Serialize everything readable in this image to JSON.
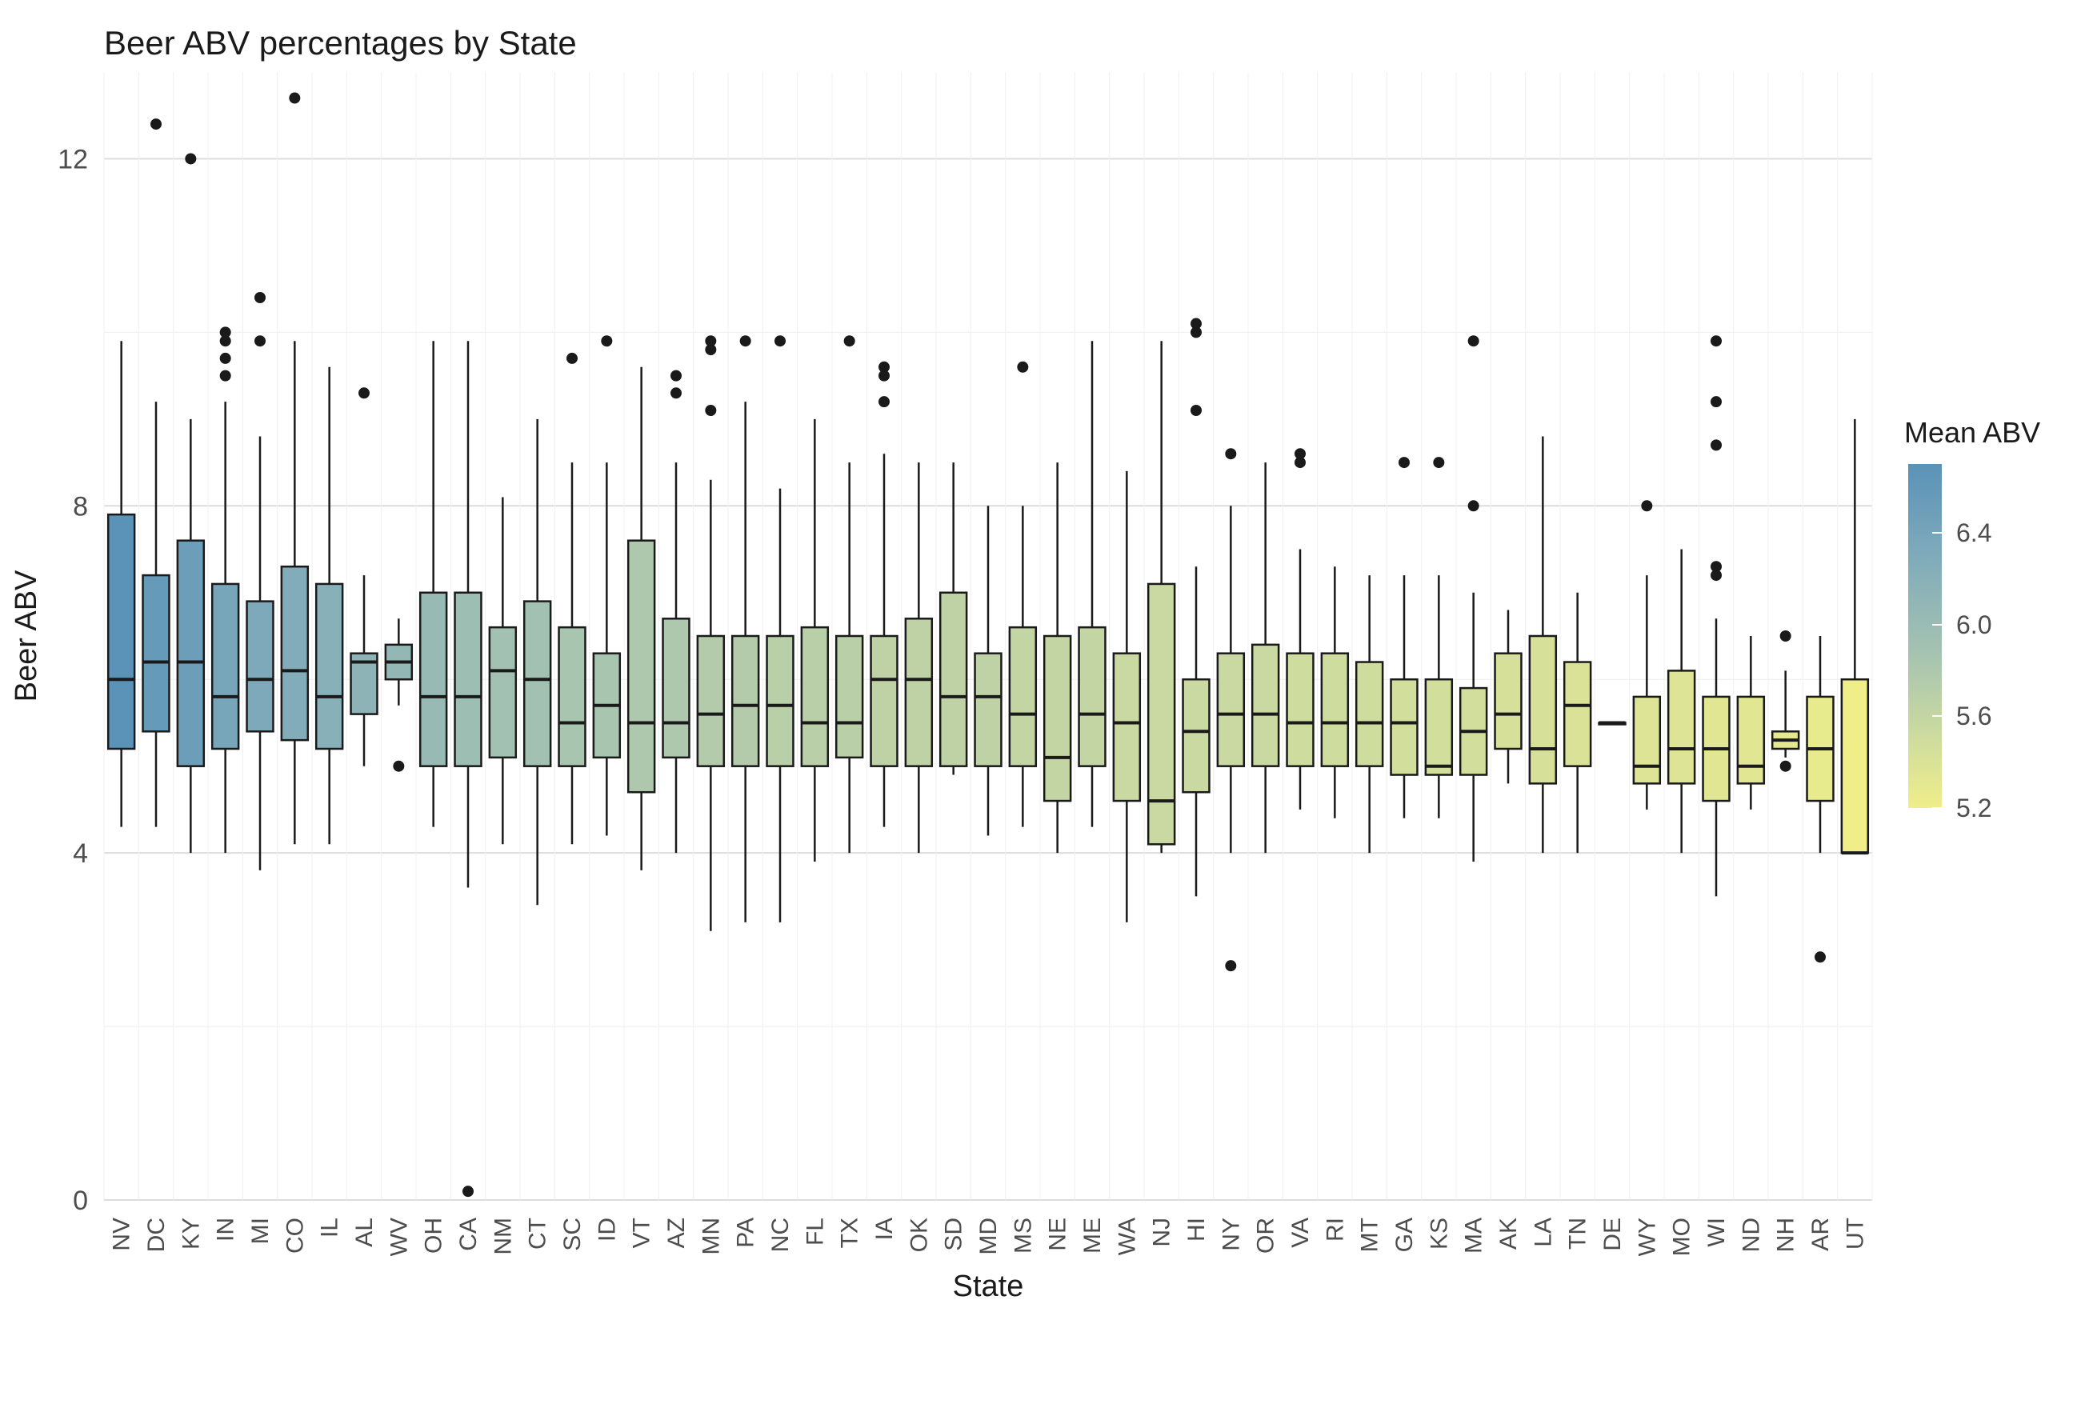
{
  "chart_data": {
    "type": "boxplot",
    "title": "Beer ABV percentages by State",
    "xlabel": "State",
    "ylabel": "Beer ABV",
    "ylim": [
      0,
      13
    ],
    "y_ticks": [
      0,
      4,
      8,
      12
    ],
    "legend": {
      "title": "Mean ABV",
      "min": 5.2,
      "max": 6.7,
      "ticks": [
        5.2,
        5.6,
        6.0,
        6.4
      ]
    },
    "categories": [
      "NV",
      "DC",
      "KY",
      "IN",
      "MI",
      "CO",
      "IL",
      "AL",
      "WV",
      "OH",
      "CA",
      "NM",
      "CT",
      "SC",
      "ID",
      "VT",
      "AZ",
      "MN",
      "PA",
      "NC",
      "FL",
      "TX",
      "IA",
      "OK",
      "SD",
      "MD",
      "MS",
      "NE",
      "ME",
      "WA",
      "NJ",
      "HI",
      "NY",
      "OR",
      "VA",
      "RI",
      "MT",
      "GA",
      "KS",
      "MA",
      "AK",
      "LA",
      "TN",
      "DE",
      "WY",
      "MO",
      "WI",
      "ND",
      "NH",
      "AR",
      "UT"
    ],
    "series": [
      {
        "name": "NV",
        "mean_abv": 6.7,
        "min": 4.3,
        "q1": 5.2,
        "median": 6.0,
        "q3": 7.9,
        "max": 9.9,
        "outliers": []
      },
      {
        "name": "DC",
        "mean_abv": 6.6,
        "min": 4.3,
        "q1": 5.4,
        "median": 6.2,
        "q3": 7.2,
        "max": 9.2,
        "outliers": [
          12.4
        ]
      },
      {
        "name": "KY",
        "mean_abv": 6.55,
        "min": 4.0,
        "q1": 5.0,
        "median": 6.2,
        "q3": 7.6,
        "max": 9.0,
        "outliers": [
          12.0
        ]
      },
      {
        "name": "IN",
        "mean_abv": 6.45,
        "min": 4.0,
        "q1": 5.2,
        "median": 5.8,
        "q3": 7.1,
        "max": 9.2,
        "outliers": [
          9.9,
          10.0,
          9.7,
          9.5
        ]
      },
      {
        "name": "MI",
        "mean_abv": 6.4,
        "min": 3.8,
        "q1": 5.4,
        "median": 6.0,
        "q3": 6.9,
        "max": 8.8,
        "outliers": [
          9.9,
          10.4
        ]
      },
      {
        "name": "CO",
        "mean_abv": 6.35,
        "min": 4.1,
        "q1": 5.3,
        "median": 6.1,
        "q3": 7.3,
        "max": 9.9,
        "outliers": [
          12.7
        ]
      },
      {
        "name": "IL",
        "mean_abv": 6.3,
        "min": 4.1,
        "q1": 5.2,
        "median": 5.8,
        "q3": 7.1,
        "max": 9.6,
        "outliers": []
      },
      {
        "name": "AL",
        "mean_abv": 6.25,
        "min": 5.0,
        "q1": 5.6,
        "median": 6.2,
        "q3": 6.3,
        "max": 7.2,
        "outliers": [
          9.3
        ]
      },
      {
        "name": "WV",
        "mean_abv": 6.2,
        "min": 5.7,
        "q1": 6.0,
        "median": 6.2,
        "q3": 6.4,
        "max": 6.7,
        "outliers": [
          5.0
        ]
      },
      {
        "name": "OH",
        "mean_abv": 6.15,
        "min": 4.3,
        "q1": 5.0,
        "median": 5.8,
        "q3": 7.0,
        "max": 9.9,
        "outliers": []
      },
      {
        "name": "CA",
        "mean_abv": 6.1,
        "min": 3.6,
        "q1": 5.0,
        "median": 5.8,
        "q3": 7.0,
        "max": 9.9,
        "outliers": [
          0.1
        ]
      },
      {
        "name": "NM",
        "mean_abv": 6.05,
        "min": 4.1,
        "q1": 5.1,
        "median": 6.1,
        "q3": 6.6,
        "max": 8.1,
        "outliers": []
      },
      {
        "name": "CT",
        "mean_abv": 6.05,
        "min": 3.4,
        "q1": 5.0,
        "median": 6.0,
        "q3": 6.9,
        "max": 9.0,
        "outliers": []
      },
      {
        "name": "SC",
        "mean_abv": 6.0,
        "min": 4.1,
        "q1": 5.0,
        "median": 5.5,
        "q3": 6.6,
        "max": 8.5,
        "outliers": [
          9.7
        ]
      },
      {
        "name": "ID",
        "mean_abv": 6.0,
        "min": 4.2,
        "q1": 5.1,
        "median": 5.7,
        "q3": 6.3,
        "max": 8.5,
        "outliers": [
          9.9
        ]
      },
      {
        "name": "VT",
        "mean_abv": 5.95,
        "min": 3.8,
        "q1": 4.7,
        "median": 5.5,
        "q3": 7.6,
        "max": 9.6,
        "outliers": []
      },
      {
        "name": "AZ",
        "mean_abv": 5.95,
        "min": 4.0,
        "q1": 5.1,
        "median": 5.5,
        "q3": 6.7,
        "max": 8.5,
        "outliers": [
          9.3,
          9.5
        ]
      },
      {
        "name": "MN",
        "mean_abv": 5.9,
        "min": 3.1,
        "q1": 5.0,
        "median": 5.6,
        "q3": 6.5,
        "max": 8.3,
        "outliers": [
          9.9,
          9.8,
          9.1
        ]
      },
      {
        "name": "PA",
        "mean_abv": 5.9,
        "min": 3.2,
        "q1": 5.0,
        "median": 5.7,
        "q3": 6.5,
        "max": 9.2,
        "outliers": [
          9.9
        ]
      },
      {
        "name": "NC",
        "mean_abv": 5.85,
        "min": 3.2,
        "q1": 5.0,
        "median": 5.7,
        "q3": 6.5,
        "max": 8.2,
        "outliers": [
          9.9
        ]
      },
      {
        "name": "FL",
        "mean_abv": 5.85,
        "min": 3.9,
        "q1": 5.0,
        "median": 5.5,
        "q3": 6.6,
        "max": 9.0,
        "outliers": []
      },
      {
        "name": "TX",
        "mean_abv": 5.85,
        "min": 4.0,
        "q1": 5.1,
        "median": 5.5,
        "q3": 6.5,
        "max": 8.5,
        "outliers": [
          9.9
        ]
      },
      {
        "name": "IA",
        "mean_abv": 5.8,
        "min": 4.3,
        "q1": 5.0,
        "median": 6.0,
        "q3": 6.5,
        "max": 8.6,
        "outliers": [
          9.5,
          9.6,
          9.2
        ]
      },
      {
        "name": "OK",
        "mean_abv": 5.8,
        "min": 4.0,
        "q1": 5.0,
        "median": 6.0,
        "q3": 6.7,
        "max": 8.5,
        "outliers": []
      },
      {
        "name": "SD",
        "mean_abv": 5.8,
        "min": 4.9,
        "q1": 5.0,
        "median": 5.8,
        "q3": 7.0,
        "max": 8.5,
        "outliers": []
      },
      {
        "name": "MD",
        "mean_abv": 5.8,
        "min": 4.2,
        "q1": 5.0,
        "median": 5.8,
        "q3": 6.3,
        "max": 8.0,
        "outliers": []
      },
      {
        "name": "MS",
        "mean_abv": 5.75,
        "min": 4.3,
        "q1": 5.0,
        "median": 5.6,
        "q3": 6.6,
        "max": 8.0,
        "outliers": [
          9.6
        ]
      },
      {
        "name": "NE",
        "mean_abv": 5.75,
        "min": 4.0,
        "q1": 4.6,
        "median": 5.1,
        "q3": 6.5,
        "max": 8.5,
        "outliers": []
      },
      {
        "name": "ME",
        "mean_abv": 5.75,
        "min": 4.3,
        "q1": 5.0,
        "median": 5.6,
        "q3": 6.6,
        "max": 9.9,
        "outliers": []
      },
      {
        "name": "WA",
        "mean_abv": 5.7,
        "min": 3.2,
        "q1": 4.6,
        "median": 5.5,
        "q3": 6.3,
        "max": 8.4,
        "outliers": []
      },
      {
        "name": "NJ",
        "mean_abv": 5.7,
        "min": 4.0,
        "q1": 4.1,
        "median": 4.6,
        "q3": 7.1,
        "max": 9.9,
        "outliers": []
      },
      {
        "name": "HI",
        "mean_abv": 5.7,
        "min": 3.5,
        "q1": 4.7,
        "median": 5.4,
        "q3": 6.0,
        "max": 7.3,
        "outliers": [
          9.1,
          10.0,
          10.1
        ]
      },
      {
        "name": "NY",
        "mean_abv": 5.7,
        "min": 4.0,
        "q1": 5.0,
        "median": 5.6,
        "q3": 6.3,
        "max": 8.0,
        "outliers": [
          8.6,
          2.7
        ]
      },
      {
        "name": "OR",
        "mean_abv": 5.7,
        "min": 4.0,
        "q1": 5.0,
        "median": 5.6,
        "q3": 6.4,
        "max": 8.5,
        "outliers": []
      },
      {
        "name": "VA",
        "mean_abv": 5.65,
        "min": 4.5,
        "q1": 5.0,
        "median": 5.5,
        "q3": 6.3,
        "max": 7.5,
        "outliers": [
          8.6,
          8.5
        ]
      },
      {
        "name": "RI",
        "mean_abv": 5.65,
        "min": 4.4,
        "q1": 5.0,
        "median": 5.5,
        "q3": 6.3,
        "max": 7.3,
        "outliers": []
      },
      {
        "name": "MT",
        "mean_abv": 5.65,
        "min": 4.0,
        "q1": 5.0,
        "median": 5.5,
        "q3": 6.2,
        "max": 7.2,
        "outliers": []
      },
      {
        "name": "GA",
        "mean_abv": 5.6,
        "min": 4.4,
        "q1": 4.9,
        "median": 5.5,
        "q3": 6.0,
        "max": 7.2,
        "outliers": [
          8.5
        ]
      },
      {
        "name": "KS",
        "mean_abv": 5.6,
        "min": 4.4,
        "q1": 4.9,
        "median": 5.0,
        "q3": 6.0,
        "max": 7.2,
        "outliers": [
          8.5
        ]
      },
      {
        "name": "MA",
        "mean_abv": 5.6,
        "min": 3.9,
        "q1": 4.9,
        "median": 5.4,
        "q3": 5.9,
        "max": 7.0,
        "outliers": [
          8.0,
          9.9
        ]
      },
      {
        "name": "AK",
        "mean_abv": 5.55,
        "min": 4.8,
        "q1": 5.2,
        "median": 5.6,
        "q3": 6.3,
        "max": 6.8,
        "outliers": []
      },
      {
        "name": "LA",
        "mean_abv": 5.55,
        "min": 4.0,
        "q1": 4.8,
        "median": 5.2,
        "q3": 6.5,
        "max": 8.8,
        "outliers": []
      },
      {
        "name": "TN",
        "mean_abv": 5.5,
        "min": 4.0,
        "q1": 5.0,
        "median": 5.7,
        "q3": 6.2,
        "max": 7.0,
        "outliers": []
      },
      {
        "name": "DE",
        "mean_abv": 5.5,
        "min": 5.5,
        "q1": 5.5,
        "median": 5.5,
        "q3": 5.5,
        "max": 5.5,
        "outliers": []
      },
      {
        "name": "WY",
        "mean_abv": 5.45,
        "min": 4.5,
        "q1": 4.8,
        "median": 5.0,
        "q3": 5.8,
        "max": 7.2,
        "outliers": [
          8.0
        ]
      },
      {
        "name": "MO",
        "mean_abv": 5.45,
        "min": 4.0,
        "q1": 4.8,
        "median": 5.2,
        "q3": 6.1,
        "max": 7.5,
        "outliers": []
      },
      {
        "name": "WI",
        "mean_abv": 5.4,
        "min": 3.5,
        "q1": 4.6,
        "median": 5.2,
        "q3": 5.8,
        "max": 6.7,
        "outliers": [
          7.2,
          7.3,
          8.7,
          9.2,
          9.9
        ]
      },
      {
        "name": "ND",
        "mean_abv": 5.4,
        "min": 4.5,
        "q1": 4.8,
        "median": 5.0,
        "q3": 5.8,
        "max": 6.5,
        "outliers": []
      },
      {
        "name": "NH",
        "mean_abv": 5.35,
        "min": 5.1,
        "q1": 5.2,
        "median": 5.3,
        "q3": 5.4,
        "max": 6.1,
        "outliers": [
          5.0,
          6.5
        ]
      },
      {
        "name": "AR",
        "mean_abv": 5.3,
        "min": 4.0,
        "q1": 4.6,
        "median": 5.2,
        "q3": 5.8,
        "max": 6.5,
        "outliers": [
          2.8
        ]
      },
      {
        "name": "UT",
        "mean_abv": 5.1,
        "min": 4.0,
        "q1": 4.0,
        "median": 4.0,
        "q3": 6.0,
        "max": 9.0,
        "outliers": []
      }
    ]
  }
}
